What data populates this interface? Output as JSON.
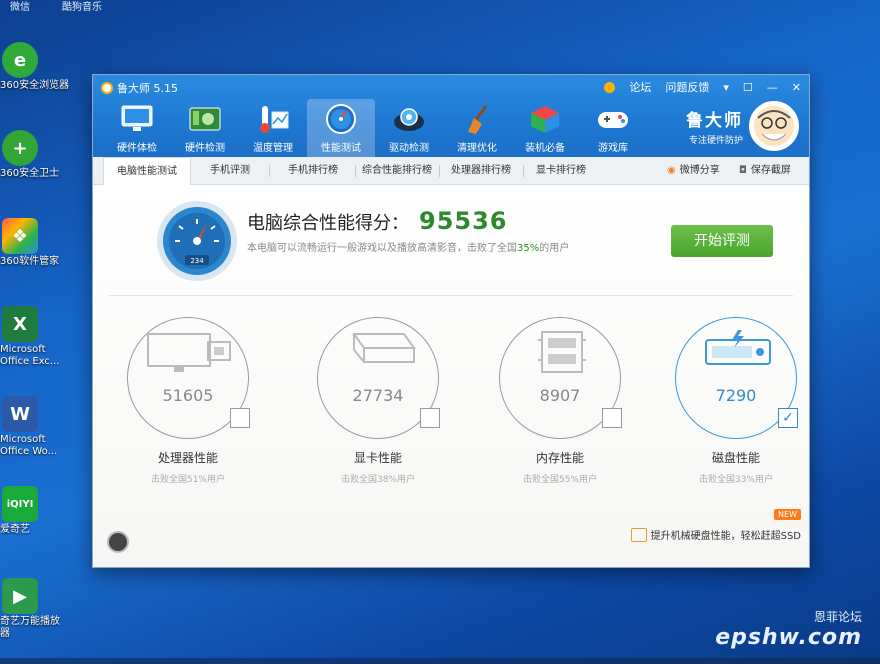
{
  "desktop": {
    "top_labels": [
      "微信",
      "酷狗音乐"
    ],
    "icons": [
      {
        "label": "360安全浏览器",
        "short": "e",
        "color": "#2faa3a",
        "icon": "browser-icon"
      },
      {
        "label": "360安全卫士",
        "short": "+",
        "color": "#31a637",
        "icon": "shield-icon"
      },
      {
        "label": "360软件管家",
        "short": "❖",
        "color": "#ffffff",
        "icon": "software-manager-icon"
      },
      {
        "label": "Microsoft Office Exc...",
        "short": "X",
        "color": "#1f7a3e",
        "icon": "excel-icon"
      },
      {
        "label": "Microsoft Office Wo...",
        "short": "W",
        "color": "#2b5aa8",
        "icon": "word-icon"
      },
      {
        "label": "爱奇艺",
        "short": "iQIYI",
        "color": "#1aaa3a",
        "icon": "iqiyi-icon"
      },
      {
        "label": "奇艺万能播放器",
        "short": "▶",
        "color": "#2b9a4a",
        "icon": "player-icon"
      }
    ]
  },
  "window": {
    "title": "鲁大师 5.15",
    "controls": {
      "forum": "论坛",
      "feedback": "问题反馈"
    },
    "nav": [
      {
        "label": "硬件体检",
        "icon": "monitor-icon",
        "active": false
      },
      {
        "label": "硬件检测",
        "icon": "circuit-board-icon",
        "active": false
      },
      {
        "label": "温度管理",
        "icon": "thermometer-icon",
        "active": false
      },
      {
        "label": "性能测试",
        "icon": "speedometer-icon",
        "active": true
      },
      {
        "label": "驱动检测",
        "icon": "gear-disk-icon",
        "active": false
      },
      {
        "label": "清理优化",
        "icon": "broom-icon",
        "active": false
      },
      {
        "label": "装机必备",
        "icon": "cube-icon",
        "active": false
      },
      {
        "label": "游戏库",
        "icon": "gamepad-icon",
        "active": false
      }
    ],
    "brand": {
      "name": "鲁大师",
      "slogan": "专注硬件防护"
    },
    "tabs": [
      "电脑性能测试",
      "手机评测",
      "手机排行榜",
      "综合性能排行榜",
      "处理器排行榜",
      "显卡排行榜"
    ],
    "tab_actions": {
      "share": "微博分享",
      "screenshot": "保存截屏"
    },
    "score": {
      "label": "电脑综合性能得分：",
      "value": "95536",
      "gauge_readout": "234",
      "desc_prefix": "本电脑可以流畅运行一般游戏以及播放高清影音，击败了全国",
      "desc_pct": "35%",
      "desc_suffix": "的用户"
    },
    "start_button": "开始评测",
    "metrics": [
      {
        "name": "处理器性能",
        "value": "51605",
        "sub": "击败全国51%用户",
        "checked": false,
        "icon": "cpu-monitor-icon"
      },
      {
        "name": "显卡性能",
        "value": "27734",
        "sub": "击败全国38%用户",
        "checked": false,
        "icon": "graphics-card-icon"
      },
      {
        "name": "内存性能",
        "value": "8907",
        "sub": "击败全国55%用户",
        "checked": false,
        "icon": "memory-chip-icon"
      },
      {
        "name": "磁盘性能",
        "value": "7290",
        "sub": "击败全国33%用户",
        "checked": true,
        "icon": "hard-disk-icon"
      }
    ],
    "footer": {
      "new_badge": "NEW",
      "ssd_text": "提升机械硬盘性能，轻松赶超SSD"
    }
  },
  "watermark": {
    "line1": "恩菲论坛",
    "line2": "epshw.com"
  },
  "colors": {
    "header_blue": "#1e78d2",
    "score_green": "#2c8a2c",
    "button_green": "#4aa52d",
    "disk_blue": "#3a88c4"
  }
}
